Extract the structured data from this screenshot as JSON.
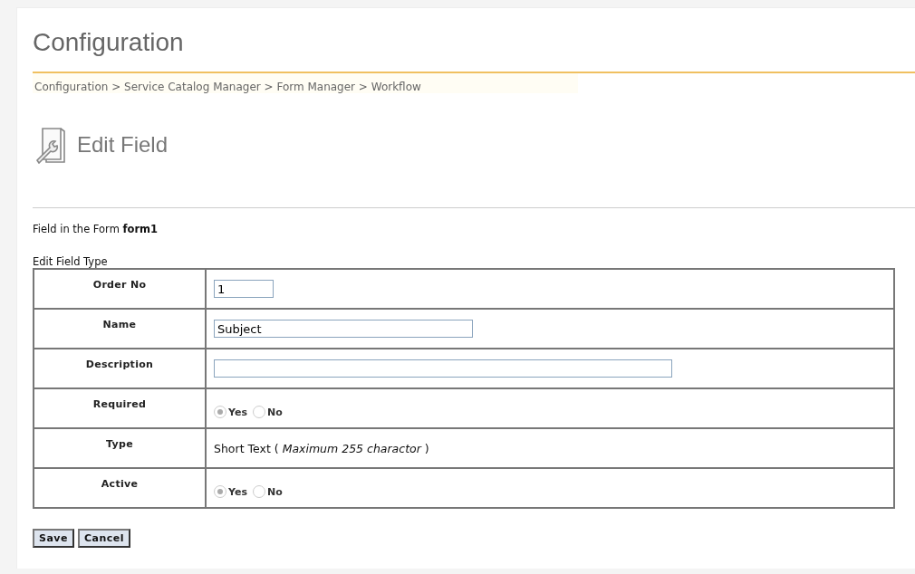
{
  "page_title": "Configuration",
  "breadcrumb": "Configuration > Service Catalog Manager > Form Manager > Workflow",
  "section_title": "Edit Field",
  "form_caption": "Field in the Form **form1**",
  "table_caption": "Edit Field Type",
  "rows": [
    {
      "kind": "input",
      "label": "Order No",
      "value": "1"
    },
    {
      "kind": "input",
      "label": "Name",
      "value": "Subject"
    },
    {
      "kind": "input",
      "label": "Description"
    },
    {
      "kind": "radio",
      "label": "Required",
      "options": [
        {
          "label": "Yes",
          "selected": true
        },
        {
          "label": "No",
          "selected": false
        }
      ]
    },
    {
      "kind": "text",
      "label": "Type",
      "text": "Short Text ( *Maximum 255 charactor* )"
    },
    {
      "kind": "radio",
      "label": "Active",
      "options": [
        {
          "label": "Yes",
          "selected": true
        },
        {
          "label": "No",
          "selected": false
        }
      ]
    }
  ],
  "buttons": [
    "Save",
    "Cancel"
  ]
}
